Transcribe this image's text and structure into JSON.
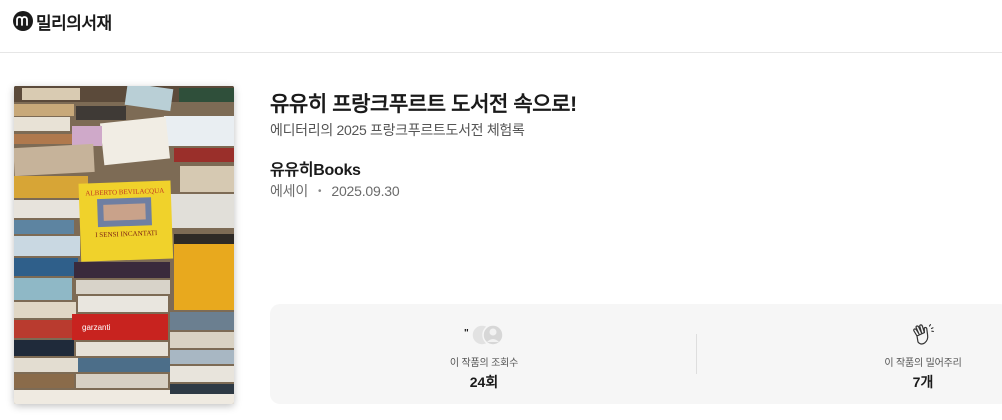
{
  "header": {
    "logo_text": "밀리의서재"
  },
  "book": {
    "title": "유유히 프랑크푸르트 도서전 속으로!",
    "subtitle": "에디터리의 2025 프랑크푸르트도서전 체험록",
    "author": "유유히Books",
    "category": "에세이",
    "separator": "•",
    "date": "2025.09.30",
    "cover": {
      "book_titles": [
        "ALBERTO BEVILACQUA",
        "I SENSI INCANTATI",
        "garzanti"
      ]
    }
  },
  "stats": {
    "views": {
      "label": "이 작품의 조회수",
      "value": "24회",
      "icon": "views-avatars-icon"
    },
    "cheer": {
      "label": "이 작품의 밀어주리",
      "value": "7개",
      "icon": "clap-hands-icon"
    }
  },
  "colors": {
    "brand": "#1a1a1a",
    "panel": "#f6f6f6",
    "divider": "#e6e6e6"
  }
}
